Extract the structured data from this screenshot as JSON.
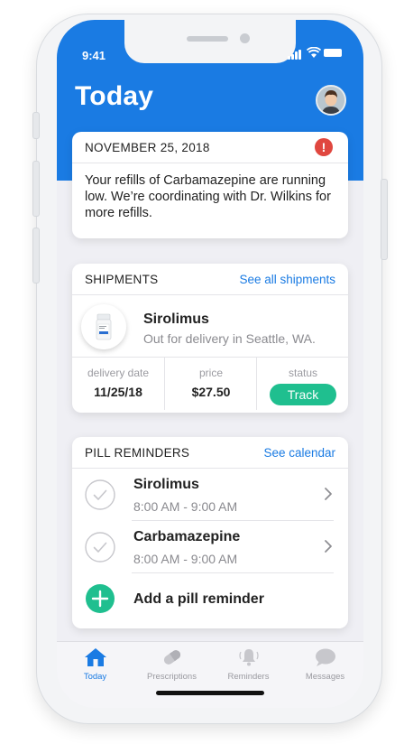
{
  "status_bar": {
    "time": "9:41"
  },
  "header": {
    "title": "Today"
  },
  "alert_card": {
    "date": "NOVEMBER 25, 2018",
    "message": "Your refills of Carbamazepine are running low. We’re coordinating with Dr. Wilkins for more refills."
  },
  "shipments": {
    "heading": "SHIPMENTS",
    "link": "See all shipments",
    "item": {
      "name": "Sirolimus",
      "status": "Out for delivery in Seattle, WA."
    },
    "stats": {
      "delivery_label": "delivery date",
      "delivery_value": "11/25/18",
      "price_label": "price",
      "price_value": "$27.50",
      "status_label": "status",
      "status_button": "Track"
    }
  },
  "reminders": {
    "heading": "PILL REMINDERS",
    "link": "See calendar",
    "items": [
      {
        "name": "Sirolimus",
        "time": "8:00 AM - 9:00 AM"
      },
      {
        "name": "Carbamazepine",
        "time": "8:00 AM - 9:00 AM"
      }
    ],
    "add_label": "Add a pill reminder"
  },
  "tabs": [
    {
      "label": "Today",
      "icon": "home-icon"
    },
    {
      "label": "Prescriptions",
      "icon": "pill-icon"
    },
    {
      "label": "Reminders",
      "icon": "bell-icon"
    },
    {
      "label": "Messages",
      "icon": "chat-bubble-icon"
    }
  ],
  "colors": {
    "primary": "#1a7be3",
    "accent": "#1fbf8f",
    "alert": "#e0473f"
  }
}
